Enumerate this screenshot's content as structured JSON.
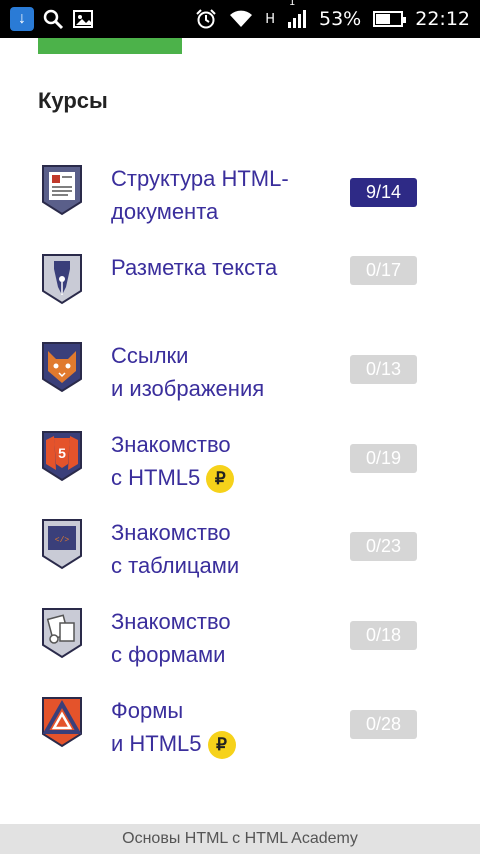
{
  "statusbar": {
    "app_letter": "↓",
    "battery_percent": "53%",
    "battery_level": 0.53,
    "time": "22:12",
    "network_label": "H",
    "sim_label": "1"
  },
  "section": {
    "title": "Курсы"
  },
  "courses": [
    {
      "line1": "Структура HTML-",
      "line2": "документа",
      "progress": "9/14",
      "paid": false,
      "active": true,
      "icon": "document-shield-icon"
    },
    {
      "line1": "Разметка текста",
      "line2": "",
      "progress": "0/17",
      "paid": false,
      "active": false,
      "icon": "pen-nib-shield-icon"
    },
    {
      "line1": "Ссылки",
      "line2": "и изображения",
      "progress": "0/13",
      "paid": false,
      "active": false,
      "icon": "cat-shield-icon"
    },
    {
      "line1": "Знакомство",
      "line2": "с HTML5",
      "progress": "0/19",
      "paid": true,
      "active": false,
      "icon": "html5-shield-icon"
    },
    {
      "line1": "Знакомство",
      "line2": "с таблицами",
      "progress": "0/23",
      "paid": false,
      "active": false,
      "icon": "code-shield-icon"
    },
    {
      "line1": "Знакомство",
      "line2": "с формами",
      "progress": "0/18",
      "paid": false,
      "active": false,
      "icon": "forms-shield-icon"
    },
    {
      "line1": "Формы",
      "line2": "и HTML5",
      "progress": "0/28",
      "paid": true,
      "active": false,
      "icon": "triangle-shield-icon"
    }
  ],
  "paid_symbol": "₽",
  "footer": {
    "text": "Основы HTML с HTML Academy"
  },
  "colors": {
    "accent": "#3a2e9c",
    "progress_active": "#2e2a86",
    "progress_inactive": "#d6d6d6",
    "paid_badge": "#f6d21a",
    "top_button": "#4cb24a"
  }
}
